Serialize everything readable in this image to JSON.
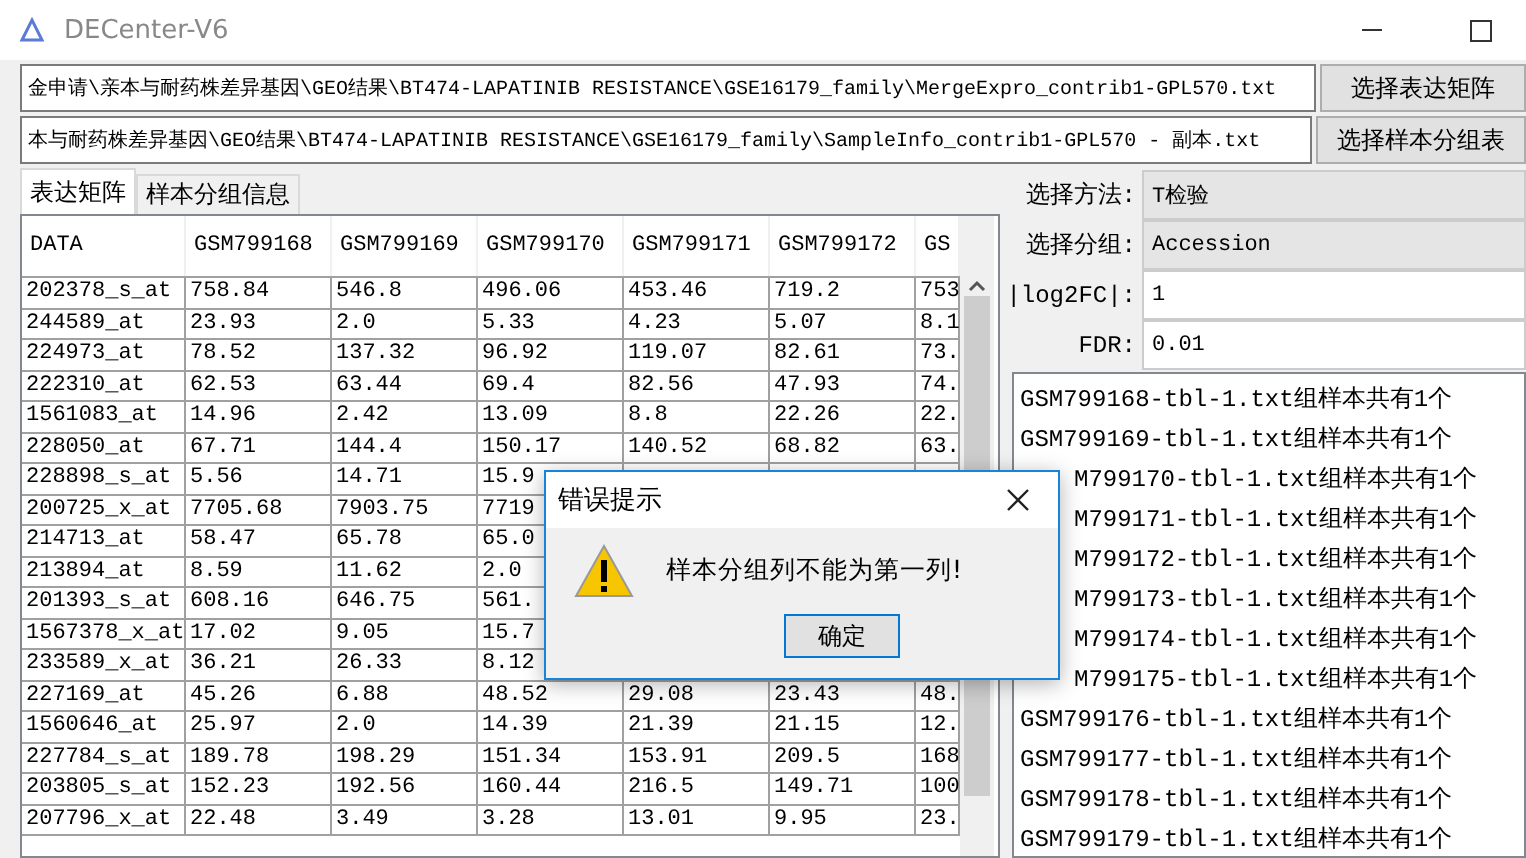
{
  "window": {
    "title": "DECenter-V6"
  },
  "paths": [
    {
      "value": "金申请\\亲本与耐药株差异基因\\GEO结果\\BT474-LAPATINIB RESISTANCE\\GSE16179_family\\MergeExpro_contrib1-GPL570.txt",
      "button": "选择表达矩阵"
    },
    {
      "value": "本与耐药株差异基因\\GEO结果\\BT474-LAPATINIB RESISTANCE\\GSE16179_family\\SampleInfo_contrib1-GPL570 - 副本.txt",
      "button": "选择样本分组表"
    }
  ],
  "tabs": [
    {
      "label": "表达矩阵",
      "selected": true
    },
    {
      "label": "样本分组信息",
      "selected": false
    }
  ],
  "table": {
    "columns": [
      "DATA",
      "GSM799168",
      "GSM799169",
      "GSM799170",
      "GSM799171",
      "GSM799172",
      "GS"
    ],
    "rows": [
      [
        "202378_s_at",
        "758.84",
        "546.8",
        "496.06",
        "453.46",
        "719.2",
        "753"
      ],
      [
        "244589_at",
        "23.93",
        "2.0",
        "5.33",
        "4.23",
        "5.07",
        "8.1"
      ],
      [
        "224973_at",
        "78.52",
        "137.32",
        "96.92",
        "119.07",
        "82.61",
        "73."
      ],
      [
        "222310_at",
        "62.53",
        "63.44",
        "69.4",
        "82.56",
        "47.93",
        "74."
      ],
      [
        "1561083_at",
        "14.96",
        "2.42",
        "13.09",
        "8.8",
        "22.26",
        "22."
      ],
      [
        "228050_at",
        "67.71",
        "144.4",
        "150.17",
        "140.52",
        "68.82",
        "63."
      ],
      [
        "228898_s_at",
        "5.56",
        "14.71",
        "15.9",
        null,
        null,
        null
      ],
      [
        "200725_x_at",
        "7705.68",
        "7903.75",
        "7719",
        null,
        null,
        null
      ],
      [
        "214713_at",
        "58.47",
        "65.78",
        "65.0",
        null,
        null,
        null
      ],
      [
        "213894_at",
        "8.59",
        "11.62",
        "2.0",
        null,
        null,
        null
      ],
      [
        "201393_s_at",
        "608.16",
        "646.75",
        "561.",
        null,
        null,
        null
      ],
      [
        "1567378_x_at",
        "17.02",
        "9.05",
        "15.7",
        null,
        null,
        null
      ],
      [
        "233589_x_at",
        "36.21",
        "26.33",
        "8.12",
        null,
        null,
        null
      ],
      [
        "227169_at",
        "45.26",
        "6.88",
        "48.52",
        "29.08",
        "23.43",
        "48."
      ],
      [
        "1560646_at",
        "25.97",
        "2.0",
        "14.39",
        "21.39",
        "21.15",
        "12."
      ],
      [
        "227784_s_at",
        "189.78",
        "198.29",
        "151.34",
        "153.91",
        "209.5",
        "168"
      ],
      [
        "203805_s_at",
        "152.23",
        "192.56",
        "160.44",
        "216.5",
        "149.71",
        "100"
      ],
      [
        "207796_x_at",
        "22.48",
        "3.49",
        "3.28",
        "13.01",
        "9.95",
        "23."
      ]
    ]
  },
  "settings": [
    {
      "kind": "select",
      "label": "选择方法:",
      "value": "T检验"
    },
    {
      "kind": "select",
      "label": "选择分组:",
      "value": "Accession"
    },
    {
      "kind": "input",
      "label": "|log2FC|:",
      "value": "1"
    },
    {
      "kind": "input",
      "label": "FDR:",
      "value": "0.01"
    }
  ],
  "groups": [
    {
      "text": "GSM799168-tbl-1.txt组样本共有1个",
      "covered": false
    },
    {
      "text": "GSM799169-tbl-1.txt组样本共有1个",
      "covered": false
    },
    {
      "text": "M799170-tbl-1.txt组样本共有1个",
      "covered": true
    },
    {
      "text": "M799171-tbl-1.txt组样本共有1个",
      "covered": true
    },
    {
      "text": "M799172-tbl-1.txt组样本共有1个",
      "covered": true
    },
    {
      "text": "M799173-tbl-1.txt组样本共有1个",
      "covered": true
    },
    {
      "text": "M799174-tbl-1.txt组样本共有1个",
      "covered": true
    },
    {
      "text": "M799175-tbl-1.txt组样本共有1个",
      "covered": true
    },
    {
      "text": "GSM799176-tbl-1.txt组样本共有1个",
      "covered": false
    },
    {
      "text": "GSM799177-tbl-1.txt组样本共有1个",
      "covered": false
    },
    {
      "text": "GSM799178-tbl-1.txt组样本共有1个",
      "covered": false
    },
    {
      "text": "GSM799179-tbl-1.txt组样本共有1个",
      "covered": false
    }
  ],
  "dialog": {
    "title": "错误提示",
    "message": "样本分组列不能为第一列!",
    "button": "确定"
  }
}
